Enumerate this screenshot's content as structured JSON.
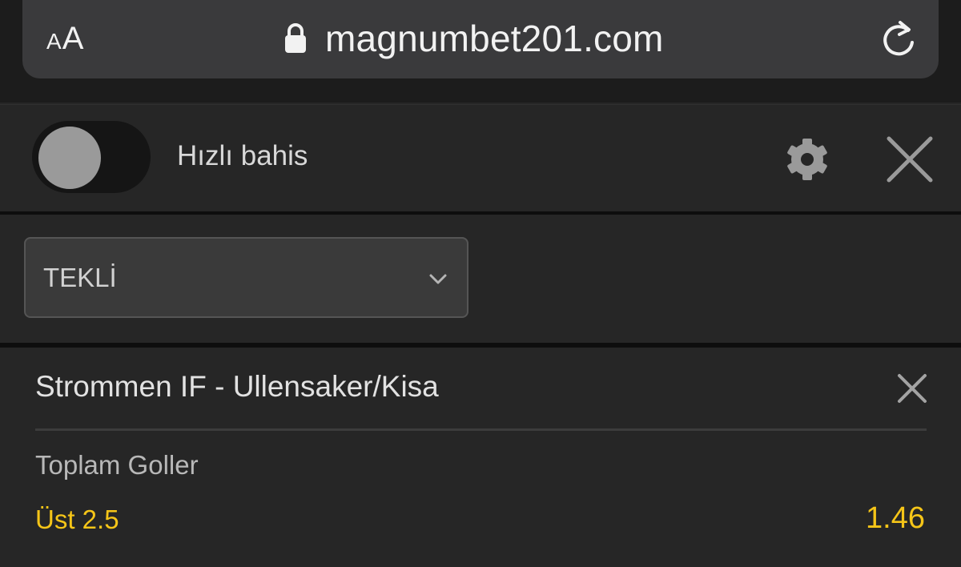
{
  "browser": {
    "reader_small": "A",
    "reader_big": "A",
    "url": "magnumbet201.com",
    "icons": [
      "lock-icon",
      "reload-icon"
    ]
  },
  "header": {
    "quick_bet_label": "Hızlı bahis",
    "quick_bet_enabled": false,
    "icons": [
      "gear-icon",
      "close-icon"
    ]
  },
  "bet_type": {
    "selected": "TEKLİ",
    "icon": "chevron-down-icon"
  },
  "selection": {
    "match": "Strommen IF - Ullensaker/Kisa",
    "market": "Toplam Goller",
    "outcome": "Üst 2.5",
    "odds": "1.46",
    "icon": "close-icon"
  },
  "colors": {
    "accent": "#f5c518",
    "background": "#262626",
    "address_bar": "#3a3a3c",
    "toggle_off": "#151515"
  }
}
